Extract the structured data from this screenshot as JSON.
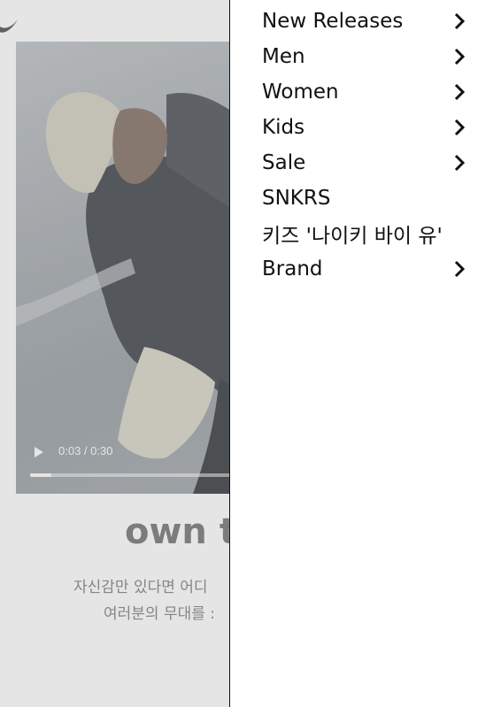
{
  "video": {
    "current_time": "0:03",
    "duration": "0:30",
    "time_display": "0:03 / 0:30",
    "progress_fraction": 0.1
  },
  "hero": {
    "headline": "own th",
    "description_line1": "자신감만 있다면 어디",
    "description_line2": "여러분의 무대를 :"
  },
  "nav": {
    "items": [
      {
        "label": "New Releases",
        "has_submenu": true
      },
      {
        "label": "Men",
        "has_submenu": true
      },
      {
        "label": "Women",
        "has_submenu": true
      },
      {
        "label": "Kids",
        "has_submenu": true
      },
      {
        "label": "Sale",
        "has_submenu": true
      },
      {
        "label": "SNKRS",
        "has_submenu": false
      },
      {
        "label": "키즈 '나이키 바이 유'",
        "has_submenu": false
      },
      {
        "label": "Brand",
        "has_submenu": true
      }
    ]
  },
  "icons": {
    "logo": "swoosh-logo-icon",
    "play": "play-icon",
    "chevron": "chevron-right-icon"
  },
  "colors": {
    "text": "#111111",
    "headline": "#7f7f7f",
    "description": "#8a8a8a"
  }
}
